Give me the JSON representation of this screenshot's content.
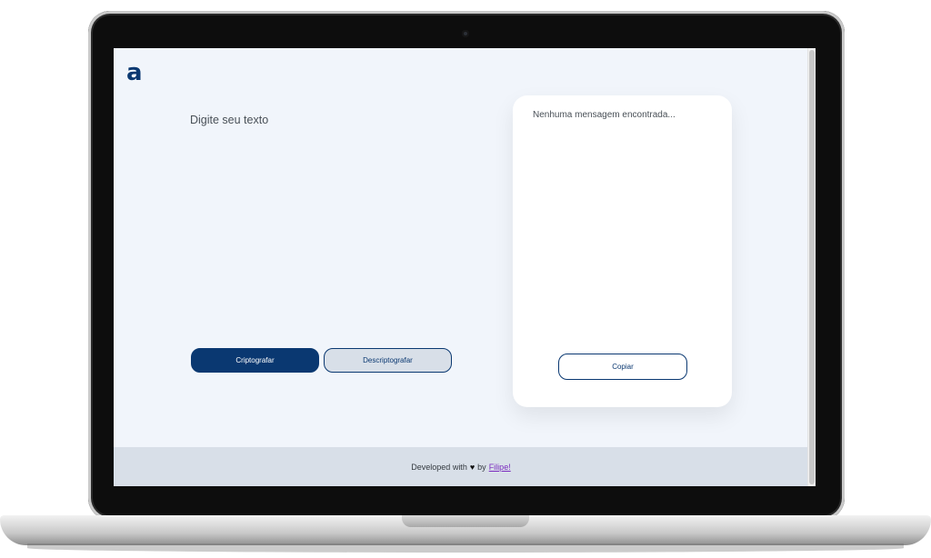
{
  "app": {
    "logo": "a"
  },
  "input": {
    "placeholder": "Digite seu texto",
    "value": ""
  },
  "buttons": {
    "encrypt_label": "Criptografar",
    "decrypt_label": "Descriptografar",
    "copy_label": "Copiar"
  },
  "output": {
    "message": "Nenhuma mensagem encontrada..."
  },
  "footer": {
    "prefix": "Developed with",
    "heart": "♥",
    "by": "by",
    "author": "Filipe!"
  },
  "colors": {
    "brand": "#0a3871",
    "page_background": "#f1f5fb",
    "footer_background": "#d8dfe8",
    "link": "#7b2cbf"
  }
}
